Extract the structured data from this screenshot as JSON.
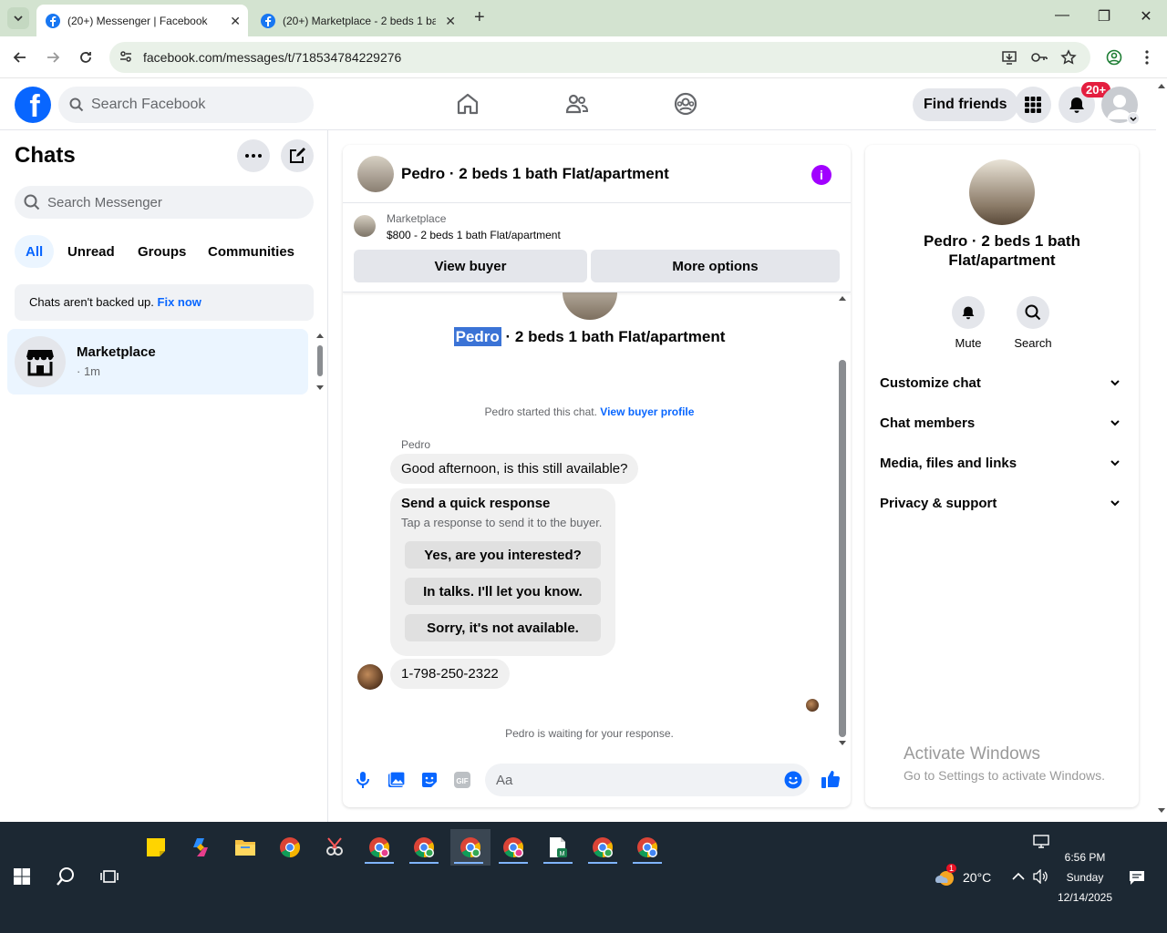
{
  "browser": {
    "tabs": [
      {
        "title": "(20+) Messenger | Facebook",
        "active": true
      },
      {
        "title": "(20+) Marketplace - 2 beds 1 ba",
        "active": false
      }
    ],
    "url": "facebook.com/messages/t/718534784229276"
  },
  "fb_header": {
    "logo": "f",
    "search_placeholder": "Search Facebook",
    "find_friends": "Find friends",
    "notifications_badge": "20+"
  },
  "sidebar": {
    "title": "Chats",
    "search_placeholder": "Search Messenger",
    "filters": [
      "All",
      "Unread",
      "Groups",
      "Communities"
    ],
    "backup_text": "Chats aren't backed up.",
    "backup_link": "Fix now",
    "chats": [
      {
        "name": "Marketplace",
        "time": "· 1m"
      }
    ]
  },
  "chat": {
    "title": "Pedro · 2 beds 1 bath Flat/apartment",
    "marketplace_label": "Marketplace",
    "listing": "$800 - 2 beds 1 bath Flat/apartment",
    "view_buyer": "View buyer",
    "more_options": "More options",
    "hero_name": "Pedro",
    "hero_rest": " · 2 beds 1 bath Flat/apartment",
    "started_text": "Pedro started this chat.",
    "started_link": "View buyer profile",
    "sender": "Pedro",
    "message1": "Good afternoon, is this still available?",
    "quick_title": "Send a quick response",
    "quick_sub": "Tap a response to send it to the buyer.",
    "quick_replies": [
      "Yes, are you interested?",
      "In talks. I'll let you know.",
      "Sorry, it's not available."
    ],
    "message2": "1-798-250-2322",
    "waiting": "Pedro is waiting for your response.",
    "composer_placeholder": "Aa"
  },
  "details": {
    "name": "Pedro · 2 beds 1 bath Flat/apartment",
    "actions": [
      "Mute",
      "Search"
    ],
    "sections": [
      "Customize chat",
      "Chat members",
      "Media, files and links",
      "Privacy & support"
    ],
    "activate_title": "Activate Windows",
    "activate_sub": "Go to Settings to activate Windows."
  },
  "taskbar": {
    "weather": "20°C",
    "weather_badge": "1",
    "time": "6:56 PM",
    "day": "Sunday",
    "date": "12/14/2025"
  },
  "colors": {
    "fb_blue": "#0866ff",
    "info_purple": "#a100ff",
    "badge_red": "#e41e3f",
    "tabbar_green": "#d3e3d0"
  }
}
